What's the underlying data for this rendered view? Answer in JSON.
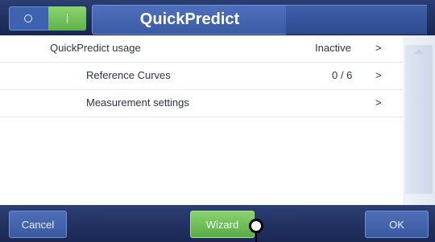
{
  "header": {
    "title": "QuickPredict",
    "toggle_state": "on"
  },
  "list": {
    "rows": [
      {
        "label": "QuickPredict usage",
        "value": "Inactive",
        "chevron": ">"
      },
      {
        "label": "Reference Curves",
        "value": "0 / 6",
        "chevron": ">"
      },
      {
        "label": "Measurement settings",
        "value": "",
        "chevron": ">"
      }
    ]
  },
  "footer": {
    "cancel_label": "Cancel",
    "wizard_label": "Wizard",
    "ok_label": "OK"
  },
  "colors": {
    "bar_dark": "#1f2f60",
    "accent_blue": "#3f5fa9",
    "accent_green": "#6fbf58"
  }
}
